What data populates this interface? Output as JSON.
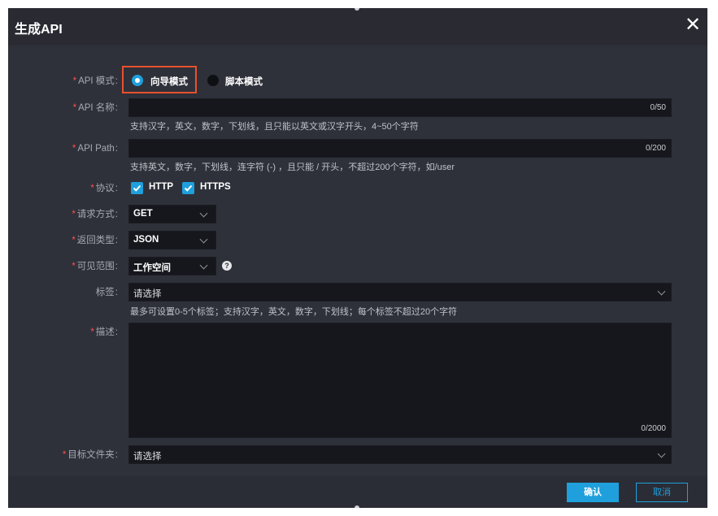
{
  "dialog": {
    "title": "生成API"
  },
  "form": {
    "mode": {
      "label": "API 模式",
      "options": [
        "向导模式",
        "脚本模式"
      ],
      "selected": "向导模式"
    },
    "name": {
      "label": "API 名称",
      "value": "",
      "counter": "0/50",
      "hint": "支持汉字，英文，数字，下划线，且只能以英文或汉字开头，4~50个字符"
    },
    "path": {
      "label": "API Path",
      "value": "",
      "counter": "0/200",
      "hint": "支持英文，数字，下划线，连字符 (-) ，且只能 / 开头，不超过200个字符，如/user"
    },
    "protocol": {
      "label": "协议",
      "options": [
        "HTTP",
        "HTTPS"
      ]
    },
    "method": {
      "label": "请求方式",
      "value": "GET"
    },
    "return_type": {
      "label": "返回类型",
      "value": "JSON"
    },
    "scope": {
      "label": "可见范围",
      "value": "工作空间"
    },
    "tags": {
      "label": "标签",
      "placeholder": "请选择",
      "hint": "最多可设置0-5个标签；支持汉字，英文，数字，下划线；每个标签不超过20个字符"
    },
    "description": {
      "label": "描述",
      "counter": "0/2000"
    },
    "folder": {
      "label": "目标文件夹",
      "placeholder": "请选择"
    }
  },
  "footer": {
    "confirm_label": "确认",
    "cancel_label": "取消"
  },
  "colors": {
    "accent": "#1fa0dc",
    "required": "#ff4d4f",
    "highlight": "#e8512d"
  }
}
